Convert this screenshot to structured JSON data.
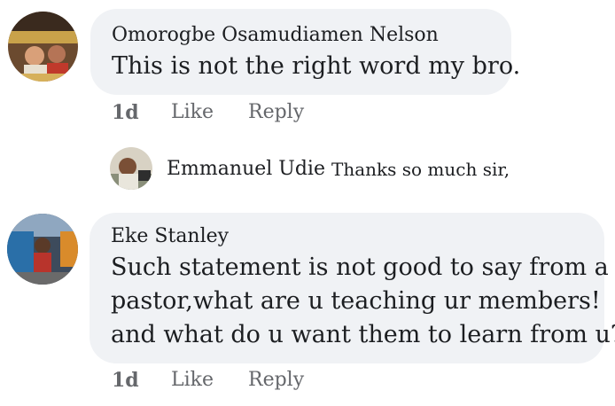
{
  "comments": [
    {
      "author": "Omorogbe Osamudiamen Nelson",
      "lines": [
        "This is not the right word my bro."
      ],
      "age": "1d",
      "like_label": "Like",
      "reply_label": "Reply"
    },
    {
      "author": "Eke Stanley",
      "lines": [
        "Such statement is not good to say from a",
        "pastor,what are u teaching ur members!",
        "and what do u want them to learn from u?"
      ],
      "age": "1d",
      "like_label": "Like",
      "reply_label": "Reply"
    }
  ],
  "reply_preview": {
    "author": "Emmanuel Udie",
    "text": "Thanks so much sir,"
  },
  "colors": {
    "bubble": "#f0f2f5",
    "text": "#1c1e21",
    "secondary": "#65676b"
  }
}
